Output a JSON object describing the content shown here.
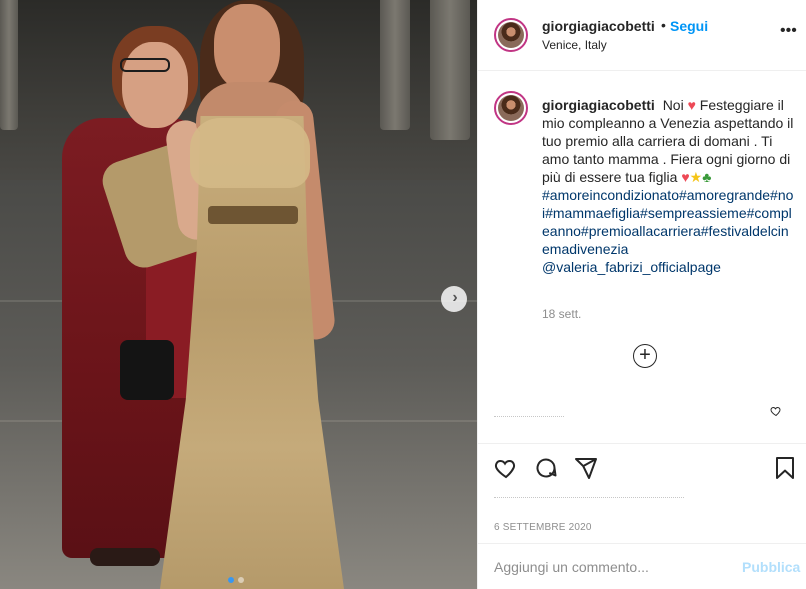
{
  "post": {
    "carousel": {
      "slide_count": 2,
      "active_slide": 1
    }
  },
  "header": {
    "username": "giorgiagiacobetti",
    "separator": "•",
    "follow_label": "Segui",
    "location": "Venice, Italy",
    "more_glyph": "•••"
  },
  "caption": {
    "username": "giorgiagiacobetti",
    "text_1": "Noi",
    "text_2": "Festeggiare il mio compleanno a Venezia aspettando il tuo premio alla carriera di domani . Ti amo tanto mamma . Fiera ogni giorno di più di essere tua figlia",
    "hashtags": "#amoreincondizionato#amoregrande#noi#mammaefiglia#sempreassieme#compleanno#premioallacarriera#festivaldelcinemadivenezia",
    "mention": "@valeria_fabrizi_officialpage",
    "relative_time": "18 sett."
  },
  "icons": {
    "heart_emoji": "heart-emoji",
    "star_emoji": "star-emoji",
    "clover_emoji": "clover-emoji",
    "load_more": "plus-circle-icon"
  },
  "actions": {
    "date": "6 SETTEMBRE 2020"
  },
  "comment_box": {
    "placeholder": "Aggiungi un commento...",
    "publish_label": "Pubblica"
  },
  "colors": {
    "follow_blue": "#0095f6",
    "publish_disabled": "#b2dffc",
    "hashtag": "#00376b",
    "heart_red": "#ed4956",
    "meta_gray": "#8e8e8e",
    "border": "#efefef"
  }
}
